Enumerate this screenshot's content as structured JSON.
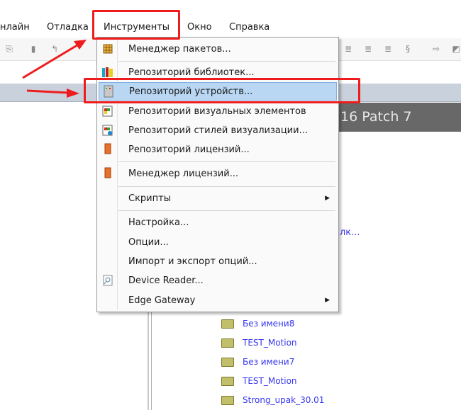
{
  "menubar": {
    "items": [
      "нлайн",
      "Отладка",
      "Инструменты",
      "Окно",
      "Справка"
    ]
  },
  "banner": {
    "text": "16 Patch 7"
  },
  "background_link": "лк...",
  "projects": [
    "Без имени8",
    "TEST_Motion",
    "Без имени7",
    "TEST_Motion",
    "Strong_upak_30.01"
  ],
  "menu": {
    "items": [
      {
        "label": "Менеджер пакетов...",
        "icon": "package-icon"
      },
      {
        "label": "Репозиторий библиотек...",
        "icon": "library-icon"
      },
      {
        "label": "Репозиторий устройств...",
        "icon": "device-icon",
        "highlighted": true
      },
      {
        "label": "Репозиторий визуальных элементов",
        "icon": "visual-elements-icon"
      },
      {
        "label": "Репозиторий стилей визуализации...",
        "icon": "visual-styles-icon"
      },
      {
        "label": "Репозиторий лицензий...",
        "icon": "license-icon"
      },
      {
        "label": "Менеджер лицензий...",
        "icon": "license-icon"
      },
      {
        "label": "Скрипты",
        "submenu": true
      },
      {
        "label": "Настройка..."
      },
      {
        "label": "Опции..."
      },
      {
        "label": "Импорт и экспорт опций..."
      },
      {
        "label": "Device Reader...",
        "icon": "device-reader-icon"
      },
      {
        "label": "Edge Gateway",
        "submenu": true
      }
    ]
  },
  "colors": {
    "highlight": "#b9d7f2",
    "annotation": "#ee1c1c",
    "link": "#3636f0"
  }
}
